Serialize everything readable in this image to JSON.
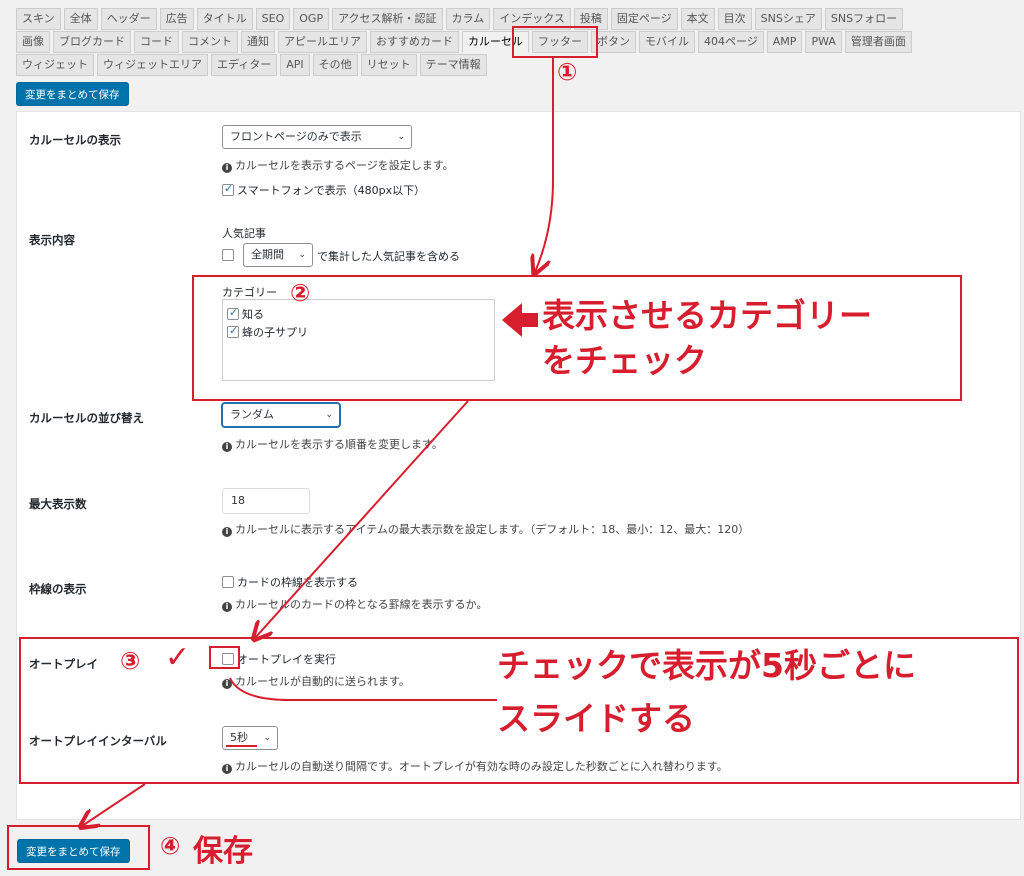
{
  "tabs": {
    "row1": [
      "スキン",
      "全体",
      "ヘッダー",
      "広告",
      "タイトル",
      "SEO",
      "OGP",
      "アクセス解析・認証",
      "カラム",
      "インデックス",
      "投稿",
      "固定ページ",
      "本文",
      "目次",
      "SNSシェア",
      "SNSフォロー"
    ],
    "row2": [
      "画像",
      "ブログカード",
      "コード",
      "コメント",
      "通知",
      "アピールエリア",
      "おすすめカード",
      "カルーセル",
      "フッター",
      "ボタン",
      "モバイル",
      "404ページ",
      "AMP",
      "PWA",
      "管理者画面"
    ],
    "row3": [
      "ウィジェット",
      "ウィジェットエリア",
      "エディター",
      "API",
      "その他",
      "リセット",
      "テーマ情報"
    ],
    "active": "カルーセル"
  },
  "save_button": "変更をまとめて保存",
  "settings": {
    "display": {
      "label": "カルーセルの表示",
      "select_value": "フロントページのみで表示",
      "desc": "カルーセルを表示するページを設定します。",
      "smartphone_label": "スマートフォンで表示（480px以下）"
    },
    "content": {
      "label": "表示内容",
      "popular_title": "人気記事",
      "period_value": "全期間",
      "popular_suffix": "で集計した人気記事を含める",
      "category_title": "カテゴリー",
      "categories": [
        "知る",
        "蜂の子サプリ"
      ]
    },
    "order": {
      "label": "カルーセルの並び替え",
      "select_value": "ランダム",
      "desc": "カルーセルを表示する順番を変更します。"
    },
    "max": {
      "label": "最大表示数",
      "value": "18",
      "desc": "カルーセルに表示するアイテムの最大表示数を設定します。（デフォルト：18、最小：12、最大：120）"
    },
    "border": {
      "label": "枠線の表示",
      "checkbox_label": "カードの枠線を表示する",
      "desc": "カルーセルのカードの枠となる罫線を表示するか。"
    },
    "autoplay": {
      "label": "オートプレイ",
      "checkbox_label": "オートプレイを実行",
      "desc": "カルーセルが自動的に送られます。"
    },
    "interval": {
      "label": "オートプレイインターバル",
      "select_value": "5秒",
      "desc": "カルーセルの自動送り間隔です。オートプレイが有効な時のみ設定した秒数ごとに入れ替わります。"
    }
  },
  "annotations": {
    "n1": "①",
    "n2": "②",
    "n3": "③",
    "n4": "④",
    "check_mark": "✓",
    "category_line1": "表示させるカテゴリー",
    "category_line2": "をチェック",
    "autoplay_line1": "チェックで表示が5秒ごとに",
    "autoplay_line2": "スライドする",
    "save_label": "保存",
    "color": "#d71e2e"
  },
  "colors": {
    "primary_button": "#0073aa",
    "panel_bg": "#ffffff",
    "page_bg": "#f1f1f1"
  }
}
